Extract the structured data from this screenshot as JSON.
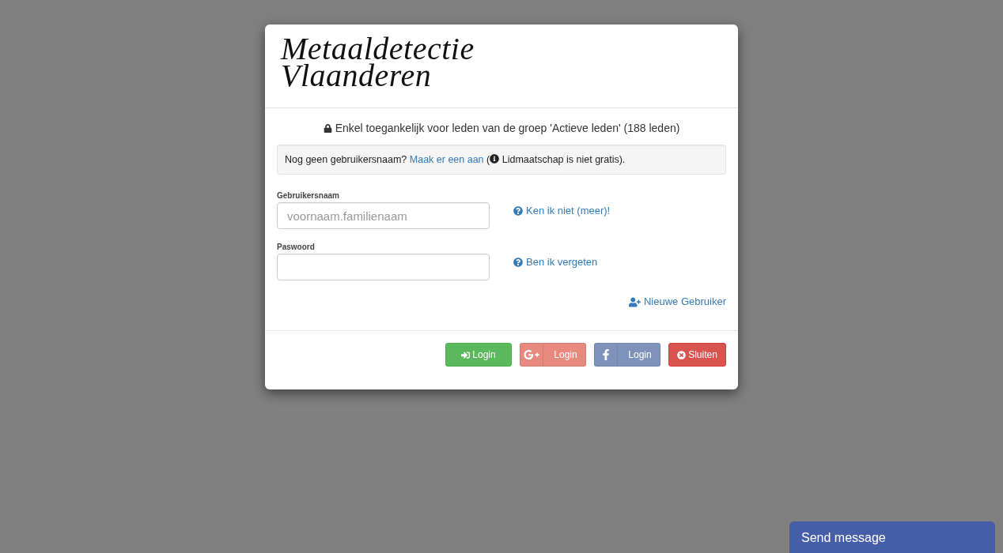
{
  "logo": {
    "lines": [
      "Metaaldetectie",
      "Vlaanderen"
    ]
  },
  "notice": {
    "text": "Enkel toegankelijk voor leden van de groep 'Actieve leden' (188 leden)"
  },
  "signup_hint": {
    "lead": "Nog geen gebruikersnaam?",
    "link": "Maak er een aan",
    "note_open": "(",
    "note": "Lidmaatschap is niet gratis)."
  },
  "fields": [
    {
      "label": "Gebruikersnaam",
      "placeholder": "voornaam.familienaam",
      "help_link": "Ken ik niet (meer)!"
    },
    {
      "label": "Paswoord",
      "help_link": "Ben ik vergeten"
    }
  ],
  "new_user_link": "Nieuwe Gebruiker",
  "buttons": [
    {
      "label": "Login",
      "kind": "login",
      "disabled": false
    },
    {
      "label": "Login",
      "kind": "google",
      "disabled": true
    },
    {
      "label": "Login",
      "kind": "facebook",
      "disabled": true
    },
    {
      "label": "Sluiten",
      "kind": "close",
      "disabled": false
    }
  ],
  "chat_widget": {
    "label": "Send message"
  }
}
